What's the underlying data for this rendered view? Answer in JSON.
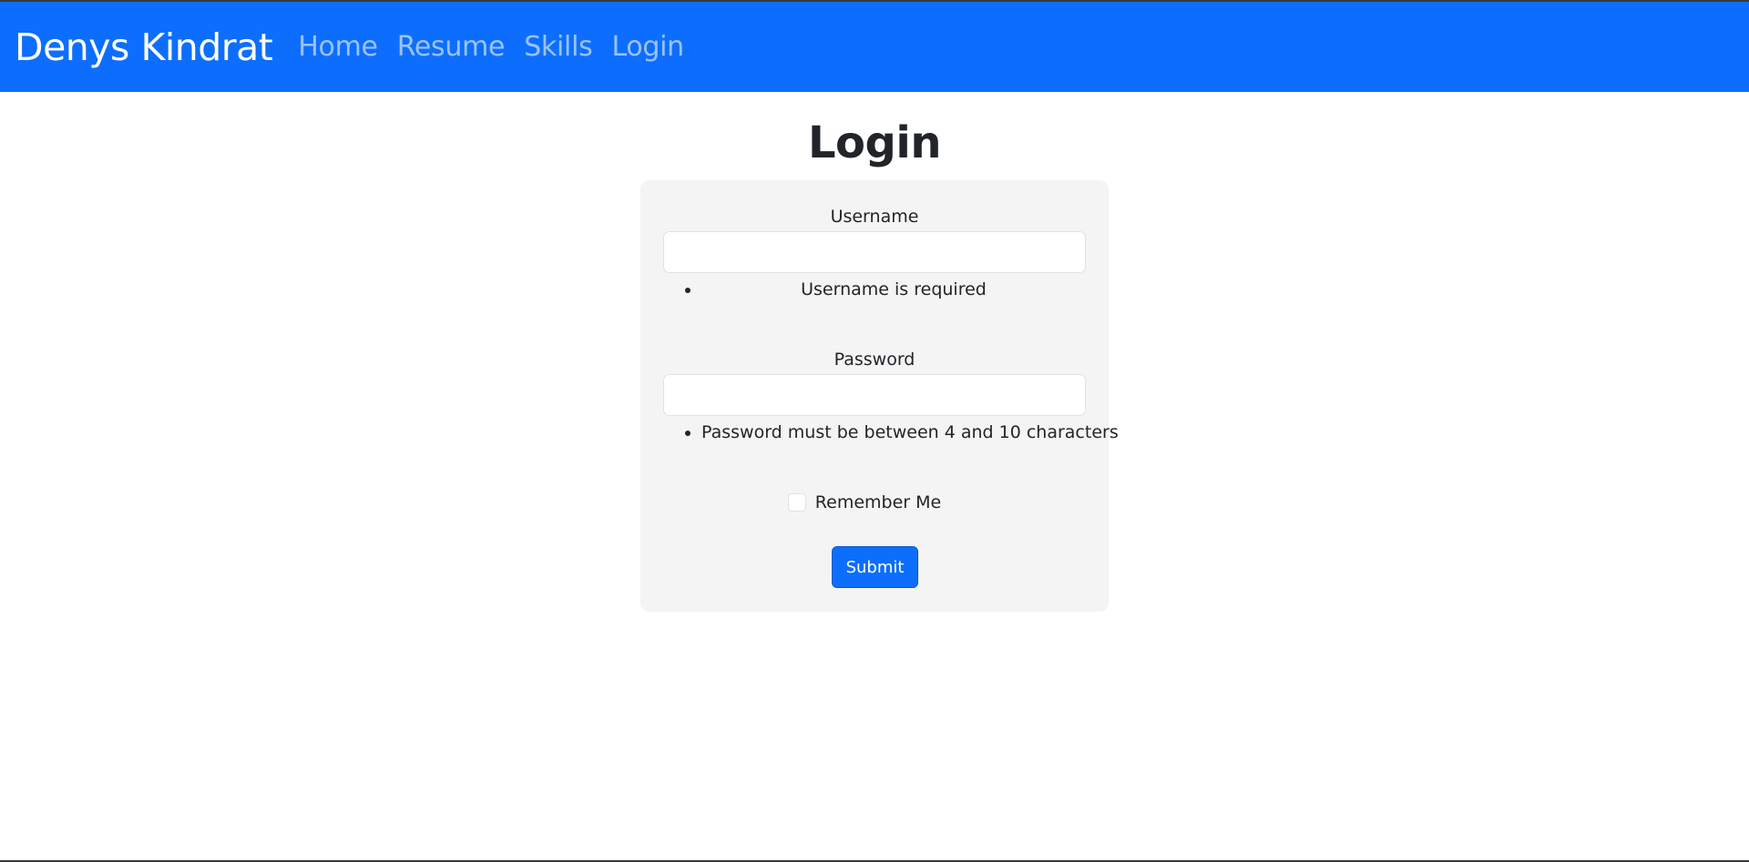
{
  "navbar": {
    "brand": "Denys Kindrat",
    "links": [
      "Home",
      "Resume",
      "Skills",
      "Login"
    ],
    "background": "#0d6efd"
  },
  "page": {
    "title": "Login"
  },
  "form": {
    "username": {
      "label": "Username",
      "value": "",
      "error": "Username is required"
    },
    "password": {
      "label": "Password",
      "value": "",
      "error": "Password must be between 4 and 10 characters"
    },
    "remember": {
      "label": "Remember Me",
      "checked": false
    },
    "submit_label": "Submit"
  }
}
